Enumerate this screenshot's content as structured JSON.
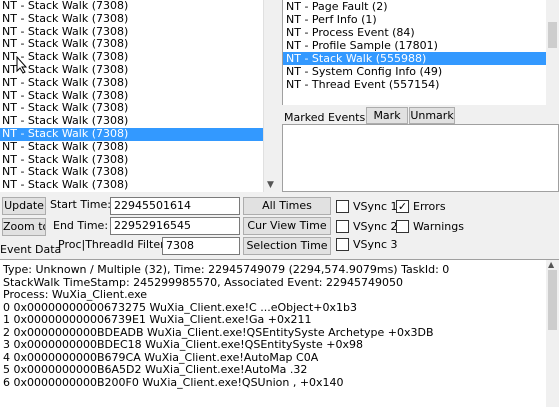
{
  "event_list": {
    "rows": [
      "NT - Stack Walk (7308)",
      "NT - Stack Walk (7308)",
      "NT - Stack Walk (7308)",
      "NT - Stack Walk (7308)",
      "NT - Stack Walk (7308)",
      "NT - Stack Walk (7308)",
      "NT - Stack Walk (7308)",
      "NT - Stack Walk (7308)",
      "NT - Stack Walk (7308)",
      "NT - Stack Walk (7308)",
      "NT - Stack Walk (7308)",
      "NT - Stack Walk (7308)",
      "NT - Stack Walk (7308)",
      "NT - Stack Walk (7308)",
      "NT - Stack Walk (7308)"
    ],
    "selected_index": 10
  },
  "type_list": {
    "rows": [
      "NT - Page Fault (2)",
      "NT - Perf Info (1)",
      "NT - Process Event (84)",
      "NT - Profile Sample (17801)",
      "NT - Stack Walk (555988)",
      "NT - System Config Info (49)",
      "NT - Thread Event (557154)"
    ],
    "selected_index": 4
  },
  "marked": {
    "label": "Marked Events:",
    "mark_button": "Mark",
    "unmark_button": "Unmark"
  },
  "controls": {
    "update_button": "Update",
    "zoom_button": "Zoom to",
    "event_data_label": "Event Data",
    "start_time_label": "Start Time:",
    "start_time_value": "22945501614",
    "end_time_label": "End Time:",
    "end_time_value": "22952916545",
    "proc_filter_label": "Proc|ThreadId Filter:",
    "proc_filter_value": "7308",
    "all_times_button": "All Times",
    "cur_view_button": "Cur View Time",
    "selection_button": "Selection Time",
    "vsync1_label": "VSync 1",
    "vsync2_label": "VSync 2",
    "vsync3_label": "VSync 3",
    "errors_label": "Errors",
    "warnings_label": "Warnings",
    "errors_checked": true,
    "vsync1_checked": false,
    "vsync2_checked": false,
    "vsync3_checked": false,
    "warnings_checked": false
  },
  "event_data": {
    "lines": [
      "Type: Unknown / Multiple (32), Time: 22945749079 (2294,574.9079ms) TaskId: 0",
      "StackWalk TimeStamp: 245299985570, Associated Event: 22945749050",
      "Process: WuXia_Client.exe",
      "0 0x00000000000673275 WuXia_Client.exe!C      ...eObject+0x1b3",
      "1 0x000000000006739E1 WuXia_Client.exe!Ga                     +0x211",
      "2 0x0000000000BDEADB WuXia_Client.exe!QSEntitySyste         Archetype +0x3DB",
      "3 0x0000000000BDEC18 WuXia_Client.exe!QSEntitySyste              +0x98",
      "4 0x0000000000B679CA WuXia_Client.exe!AutoMap                  C0A",
      "5 0x0000000000B6A5D2 WuXia_Client.exe!AutoMa               .32",
      "6 0x0000000000B200F0 WuXia_Client.exe!QSUnion              , +0x140"
    ]
  }
}
